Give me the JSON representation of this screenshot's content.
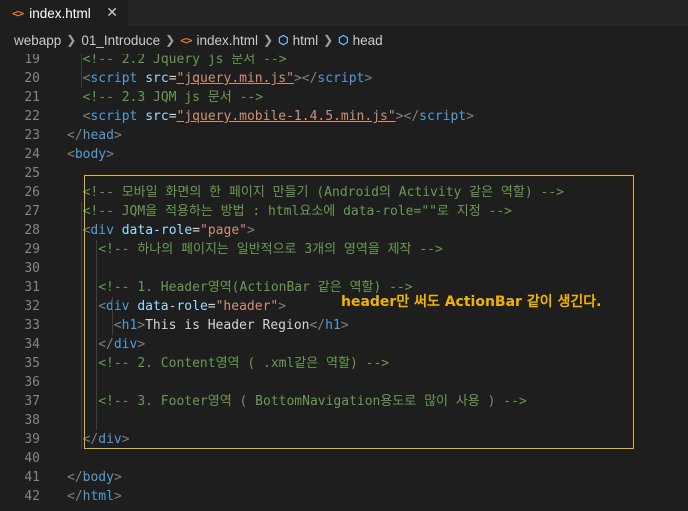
{
  "tab": {
    "label": "index.html",
    "icon": "html-file-icon",
    "close": "✕"
  },
  "breadcrumb": {
    "items": [
      "webapp",
      "01_Introduce",
      "index.html",
      "html",
      "head"
    ]
  },
  "lines": [
    {
      "n": "19",
      "indent": 2,
      "tokens": [
        [
          "cmt",
          "<!-- 2.2 Jquery js 문서 -->"
        ]
      ]
    },
    {
      "n": "20",
      "indent": 2,
      "tokens": [
        [
          "punc",
          "<"
        ],
        [
          "tag",
          "script"
        ],
        [
          "txt",
          " "
        ],
        [
          "attr",
          "src"
        ],
        [
          "txt",
          "="
        ],
        [
          "strl",
          "\"jquery.min.js\""
        ],
        [
          "punc",
          "></"
        ],
        [
          "tag",
          "script"
        ],
        [
          "punc",
          ">"
        ]
      ]
    },
    {
      "n": "21",
      "indent": 2,
      "tokens": [
        [
          "cmt",
          "<!-- 2.3 JQM js 문서 -->"
        ]
      ]
    },
    {
      "n": "22",
      "indent": 2,
      "tokens": [
        [
          "punc",
          "<"
        ],
        [
          "tag",
          "script"
        ],
        [
          "txt",
          " "
        ],
        [
          "attr",
          "src"
        ],
        [
          "txt",
          "="
        ],
        [
          "strl",
          "\"jquery.mobile-1.4.5.min.js\""
        ],
        [
          "punc",
          "></"
        ],
        [
          "tag",
          "script"
        ],
        [
          "punc",
          ">"
        ]
      ]
    },
    {
      "n": "23",
      "indent": 0,
      "tokens": [
        [
          "punc",
          "</"
        ],
        [
          "tag",
          "head"
        ],
        [
          "punc",
          ">"
        ]
      ]
    },
    {
      "n": "24",
      "indent": 0,
      "tokens": [
        [
          "punc",
          "<"
        ],
        [
          "tag",
          "body"
        ],
        [
          "punc",
          ">"
        ]
      ]
    },
    {
      "n": "25",
      "indent": 0,
      "tokens": []
    },
    {
      "n": "26",
      "indent": 2,
      "tokens": [
        [
          "cmt",
          "<!-- 모바일 화면의 한 페이지 만들기 (Android의 Activity 같은 역할) -->"
        ]
      ]
    },
    {
      "n": "27",
      "indent": 2,
      "tokens": [
        [
          "cmt",
          "<!-- JQM을 적용하는 방법 : html요소에 data-role=\"\"로 지정 -->"
        ]
      ]
    },
    {
      "n": "28",
      "indent": 2,
      "tokens": [
        [
          "punc",
          "<"
        ],
        [
          "tag",
          "div"
        ],
        [
          "txt",
          " "
        ],
        [
          "attr",
          "data-role"
        ],
        [
          "txt",
          "="
        ],
        [
          "str",
          "\"page\""
        ],
        [
          "punc",
          ">"
        ]
      ]
    },
    {
      "n": "29",
      "indent": 4,
      "tokens": [
        [
          "cmt",
          "<!-- 하나의 페이지는 일반적으로 3개의 영역을 제작 -->"
        ]
      ]
    },
    {
      "n": "30",
      "indent": 0,
      "tokens": []
    },
    {
      "n": "31",
      "indent": 4,
      "tokens": [
        [
          "cmt",
          "<!-- 1. Header영역(ActionBar 같은 역할) -->"
        ]
      ]
    },
    {
      "n": "32",
      "indent": 4,
      "tokens": [
        [
          "punc",
          "<"
        ],
        [
          "tag",
          "div"
        ],
        [
          "txt",
          " "
        ],
        [
          "attr",
          "data-role"
        ],
        [
          "txt",
          "="
        ],
        [
          "str",
          "\"header\""
        ],
        [
          "punc",
          ">"
        ]
      ]
    },
    {
      "n": "33",
      "indent": 6,
      "tokens": [
        [
          "punc",
          "<"
        ],
        [
          "tag",
          "h1"
        ],
        [
          "punc",
          ">"
        ],
        [
          "txt",
          "This is Header Region"
        ],
        [
          "punc",
          "</"
        ],
        [
          "tag",
          "h1"
        ],
        [
          "punc",
          ">"
        ]
      ]
    },
    {
      "n": "34",
      "indent": 4,
      "tokens": [
        [
          "punc",
          "</"
        ],
        [
          "tag",
          "div"
        ],
        [
          "punc",
          ">"
        ]
      ]
    },
    {
      "n": "35",
      "indent": 4,
      "tokens": [
        [
          "cmt",
          "<!-- 2. Content영역 ( .xml같은 역할) -->"
        ]
      ]
    },
    {
      "n": "36",
      "indent": 0,
      "tokens": []
    },
    {
      "n": "37",
      "indent": 4,
      "tokens": [
        [
          "cmt",
          "<!-- 3. Footer영역 ( BottomNavigation용도로 많이 사용 ) -->"
        ]
      ]
    },
    {
      "n": "38",
      "indent": 0,
      "tokens": []
    },
    {
      "n": "39",
      "indent": 2,
      "tokens": [
        [
          "punc",
          "</"
        ],
        [
          "tag",
          "div"
        ],
        [
          "punc",
          ">"
        ]
      ]
    },
    {
      "n": "40",
      "indent": 0,
      "tokens": []
    },
    {
      "n": "41",
      "indent": 0,
      "tokens": [
        [
          "punc",
          "</"
        ],
        [
          "tag",
          "body"
        ],
        [
          "punc",
          ">"
        ]
      ]
    },
    {
      "n": "42",
      "indent": 0,
      "tokens": [
        [
          "punc",
          "</"
        ],
        [
          "tag",
          "html"
        ],
        [
          "punc",
          ">"
        ]
      ]
    }
  ],
  "annotation": "header만 써도 ActionBar 같이 생긴다.",
  "colors": {
    "tag": "#569cd6",
    "attribute": "#9cdcfe",
    "string": "#ce9178",
    "comment": "#6a9955",
    "highlight_box": "#e4b429",
    "annotation": "#f0b400"
  }
}
